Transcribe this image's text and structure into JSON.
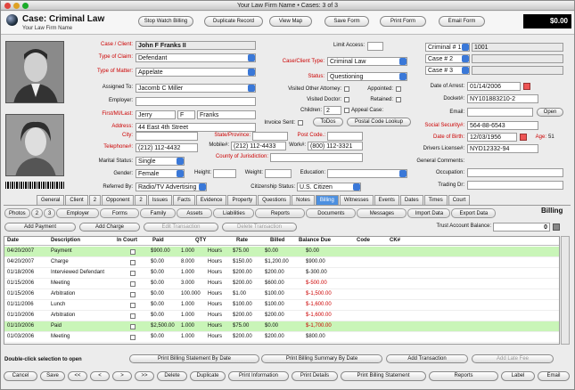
{
  "window": {
    "title": "Your Law Firm Name  •  Cases: 3 of 3"
  },
  "header": {
    "case_label": "Case:  Criminal Law",
    "firm": "Your Law Firm Name",
    "total": "$0.00",
    "buttons": [
      "Stop Watch Billing",
      "Duplicate Record",
      "View Map",
      "Save Form",
      "Print Form",
      "Email Form"
    ]
  },
  "client": {
    "case_client_lbl": "Case / Client:",
    "case_client": "John F Franks II",
    "type_claim_lbl": "Type of Claim:",
    "type_claim": "Defendant",
    "type_matter_lbl": "Type of Matter:",
    "type_matter": "Appelate",
    "assigned_lbl": "Assigned To:",
    "assigned": "Jacomb C Miller",
    "employer_lbl": "Employer:",
    "employer": "",
    "name_lbl": "First/MI/Last:",
    "first": "Jerry",
    "mi": "F",
    "last": "Franks",
    "address_lbl": "Address:",
    "address": "44 East 4th Street",
    "city_lbl": "City:",
    "city": "",
    "state_lbl": "State/Province:",
    "state": "",
    "postal_lbl": "Post Code.:",
    "postal": "",
    "phone_lbl": "Telephone#:",
    "phone": "(212) 112-4432",
    "mobile_lbl": "Mobile#:",
    "mobile": "(212) 112-4433",
    "work_lbl": "Work#:",
    "work": "(800) 112-3321",
    "county_lbl": "County of Jurisdiction:",
    "county": "",
    "marital_lbl": "Marital Status:",
    "marital": "Single",
    "gender_lbl": "Gender:",
    "gender": "Female",
    "height_lbl": "Height:",
    "weight_lbl": "Weight:",
    "education_lbl": "Education:",
    "referred_lbl": "Referred By:",
    "referred": "Radio/TV Advertising",
    "citizenship_lbl": "Citizenship Status:",
    "citizenship": "U.S. Citizen"
  },
  "middle": {
    "limit_lbl": "Limit Access:",
    "case_type_lbl": "Case/Client Type:",
    "case_type": "Criminal Law",
    "status_lbl": "Status:",
    "status": "Questioning",
    "visited_attorney": "Visited Other Attorney:",
    "appointed": "Appointed:",
    "visited_doctor": "Visited Doctor:",
    "retained": "Retained:",
    "children_lbl": "Children:",
    "children": "2",
    "appeal": "Appeal Case:",
    "invoice_lbl": "Invoice Sent:",
    "todos": "ToDos",
    "postal_lookup": "Postal Code Lookup"
  },
  "right": {
    "criminal1": "Criminal # 1",
    "criminal1_val": "1001",
    "case2": "Case # 2",
    "case3": "Case # 3",
    "arrest_lbl": "Date of Arrest:",
    "arrest": "01/14/2006",
    "docket_lbl": "Docket#:",
    "docket": "NY101883210-2",
    "email_lbl": "Email:",
    "open": "Open",
    "ssn_lbl": "Social Security#:",
    "ssn": "564-88-6543",
    "dob_lbl": "Date of Birth:",
    "dob": "12/03/1956",
    "age_lbl": "Age:",
    "age": "51",
    "license_lbl": "Drivers License#:",
    "license": "NYD12332-94",
    "comments_lbl": "General Comments:",
    "occupation_lbl": "Occupation:",
    "trading_lbl": "Trading Dr:"
  },
  "tabs1": [
    "General",
    "Client",
    "2",
    "Opponent",
    "2",
    "Issues",
    "Facts",
    "Evidence",
    "Property",
    "Questions",
    "Notes",
    "Billing",
    "Witnesses",
    "Events",
    "Dates",
    "Times",
    "Court"
  ],
  "tabs2": [
    "Photos",
    "2",
    "3",
    "Employer",
    "Forms",
    "Family",
    "Assets",
    "Liabilities",
    "Reports",
    "Documents",
    "Messages",
    "Import Data",
    "Export Data"
  ],
  "billing": {
    "title": "Billing",
    "add_payment": "Add Payment",
    "add_charge": "Add Charge",
    "edit": "Edit Transaction",
    "delete": "Delete Transaction",
    "trust_lbl": "Trust Account Balance:",
    "trust": "0"
  },
  "columns": [
    "Date",
    "Description",
    "In Court",
    "Paid",
    "QTY",
    "Rate",
    "Billed",
    "Balance Due",
    "Code",
    "CK#"
  ],
  "rows": [
    {
      "date": "04/20/2007",
      "desc": "Payment",
      "paid": "$900.00",
      "qty": "1.000",
      "unit": "Hours",
      "rate": "$75.00",
      "billed": "$0.00",
      "bal": "$0.00",
      "hl": true,
      "neg": false
    },
    {
      "date": "04/20/2007",
      "desc": "Charge",
      "paid": "$0.00",
      "qty": "8.000",
      "unit": "Hours",
      "rate": "$150.00",
      "billed": "$1,200.00",
      "bal": "$900.00",
      "hl": false,
      "neg": false
    },
    {
      "date": "01/18/2006",
      "desc": "Interviewed Defendant",
      "paid": "$0.00",
      "qty": "1.000",
      "unit": "Hours",
      "rate": "$200.00",
      "billed": "$200.00",
      "bal": "$-300.00",
      "hl": false,
      "neg": false
    },
    {
      "date": "01/15/2006",
      "desc": "Meeting",
      "paid": "$0.00",
      "qty": "3.000",
      "unit": "Hours",
      "rate": "$200.00",
      "billed": "$600.00",
      "bal": "$-500.00",
      "hl": false,
      "neg": true
    },
    {
      "date": "01/15/2006",
      "desc": "Arbitration",
      "paid": "$0.00",
      "qty": "100.000",
      "unit": "Hours",
      "rate": "$1.00",
      "billed": "$100.00",
      "bal": "$-1,500.00",
      "hl": false,
      "neg": true
    },
    {
      "date": "01/11/2006",
      "desc": "Lunch",
      "paid": "$0.00",
      "qty": "1.000",
      "unit": "Hours",
      "rate": "$100.00",
      "billed": "$100.00",
      "bal": "$-1,600.00",
      "hl": false,
      "neg": true
    },
    {
      "date": "01/10/2006",
      "desc": "Arbitration",
      "paid": "$0.00",
      "qty": "1.000",
      "unit": "Hours",
      "rate": "$200.00",
      "billed": "$200.00",
      "bal": "$-1,600.00",
      "hl": false,
      "neg": true
    },
    {
      "date": "01/10/2006",
      "desc": "Paid",
      "paid": "$2,500.00",
      "qty": "1.000",
      "unit": "Hours",
      "rate": "$75.00",
      "billed": "$0.00",
      "bal": "$-1,700.00",
      "hl": true,
      "neg": true
    },
    {
      "date": "01/03/2006",
      "desc": "Meeting",
      "paid": "$0.00",
      "qty": "1.000",
      "unit": "Hours",
      "rate": "$200.00",
      "billed": "$200.00",
      "bal": "$800.00",
      "hl": false,
      "neg": false
    }
  ],
  "footer": {
    "hint": "Double-click selection to open",
    "print_date": "Print Billing Statement By Date",
    "print_summary": "Print Billing Summary By Date",
    "add_txn": "Add Transaction",
    "late_fee": "Add Late Fee"
  },
  "bottom": [
    "Cancel",
    "Save",
    "<<",
    "<",
    ">",
    ">>",
    "Delete",
    "Duplicate",
    "Print Information",
    "Print Details",
    "Print Billing Statement",
    "Reports",
    "Label",
    "Email"
  ]
}
